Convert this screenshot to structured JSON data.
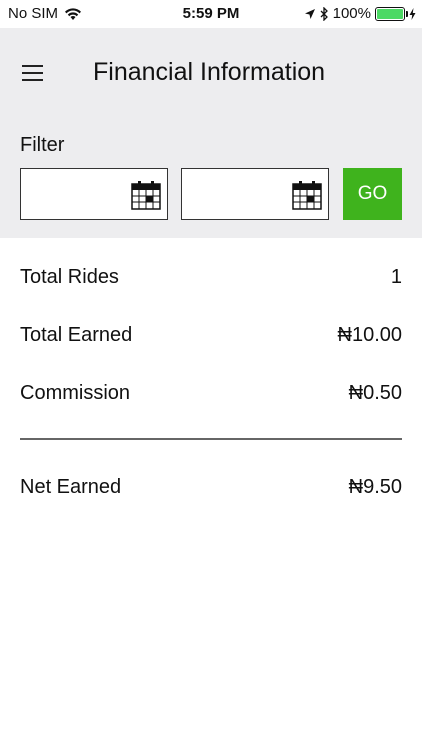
{
  "status_bar": {
    "carrier": "No SIM",
    "time": "5:59 PM",
    "battery": "100%",
    "icons": [
      "wifi-icon",
      "location-arrow-icon",
      "bluetooth-icon",
      "battery-icon",
      "charging-icon"
    ]
  },
  "header": {
    "title": "Financial Information",
    "menu_icon": "hamburger-menu-icon"
  },
  "filter": {
    "label": "Filter",
    "from_value": "",
    "to_value": "",
    "calendar_icon": "calendar-icon",
    "go_label": "GO"
  },
  "summary": {
    "rows": [
      {
        "label": "Total Rides",
        "value": "1"
      },
      {
        "label": "Total Earned",
        "value": "₦10.00"
      },
      {
        "label": "Commission",
        "value": "₦0.50"
      }
    ],
    "net": {
      "label": "Net Earned",
      "value": "₦9.50"
    }
  },
  "colors": {
    "go_button": "#3fb31d",
    "header_bg": "#ededef",
    "battery": "#4cd964"
  }
}
